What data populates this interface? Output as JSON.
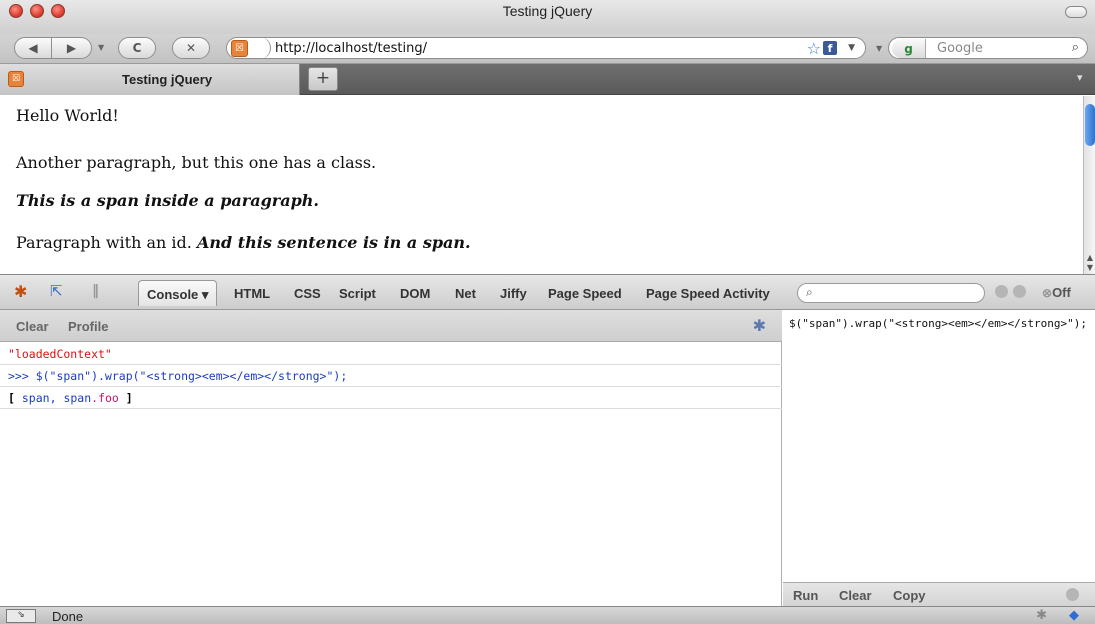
{
  "window": {
    "title": "Testing jQuery"
  },
  "navbar": {
    "back_glyph": "◀",
    "forward_glyph": "▶",
    "reload_glyph": "C",
    "stop_glyph": "✕",
    "url": "http://localhost/testing/",
    "favicon_glyph": "☒",
    "star_glyph": "☆",
    "facebook_glyph": "f",
    "dropdown_glyph": "▼",
    "history_glyph": "▼",
    "search_engine": "g",
    "search_placeholder": "Google",
    "search_glyph": "⌕"
  },
  "tabs": {
    "active_label": "Testing jQuery",
    "new_tab_glyph": "+",
    "list_glyph": "▾"
  },
  "page": {
    "p1": "Hello World!",
    "p2": "Another paragraph, but this one has a class.",
    "p3": "This is a span inside a paragraph.",
    "p4_text": "Paragraph with an id. ",
    "p4_span": "And this sentence is in a span.",
    "scroll_up": "▲",
    "scroll_down": "▼"
  },
  "firebug": {
    "tabs": {
      "console": "Console ▾",
      "html": "HTML",
      "css": "CSS",
      "script": "Script",
      "dom": "DOM",
      "net": "Net",
      "jiffy": "Jiffy",
      "pagespeed": "Page Speed",
      "pagespeedactivity": "Page Speed Activity"
    },
    "bug_glyph": "✱",
    "inspect_glyph": "⇱",
    "pause_glyph": "‖",
    "search_glyph": "⌕",
    "off_label": "Off",
    "off_glyph": "⊗"
  },
  "console": {
    "clear_label": "Clear",
    "profile_label": "Profile",
    "bug_glyph": "✱",
    "rows": [
      "\"loadedContext\"",
      ">>> $(\"span\").wrap(\"<strong><em></em></strong>\");"
    ],
    "row3": {
      "open": "[",
      "obj1": "span",
      "sep": ",",
      "obj2_tag": "span",
      "obj2_class": ".foo",
      "close": "]"
    }
  },
  "editor": {
    "text": "$(\"span\").wrap(\"<strong><em></em></strong>\");",
    "run_label": "Run",
    "clear_label": "Clear",
    "copy_label": "Copy"
  },
  "status": {
    "text": "Done",
    "toggle_glyph": "⇘",
    "bug_glyph": "✱",
    "addon_glyph": "◆"
  },
  "colors": {
    "log_string": "#dd1111",
    "log_command": "#1a3cc8",
    "log_class": "#c2186b",
    "scroll_thumb": "#2f6fc9"
  }
}
